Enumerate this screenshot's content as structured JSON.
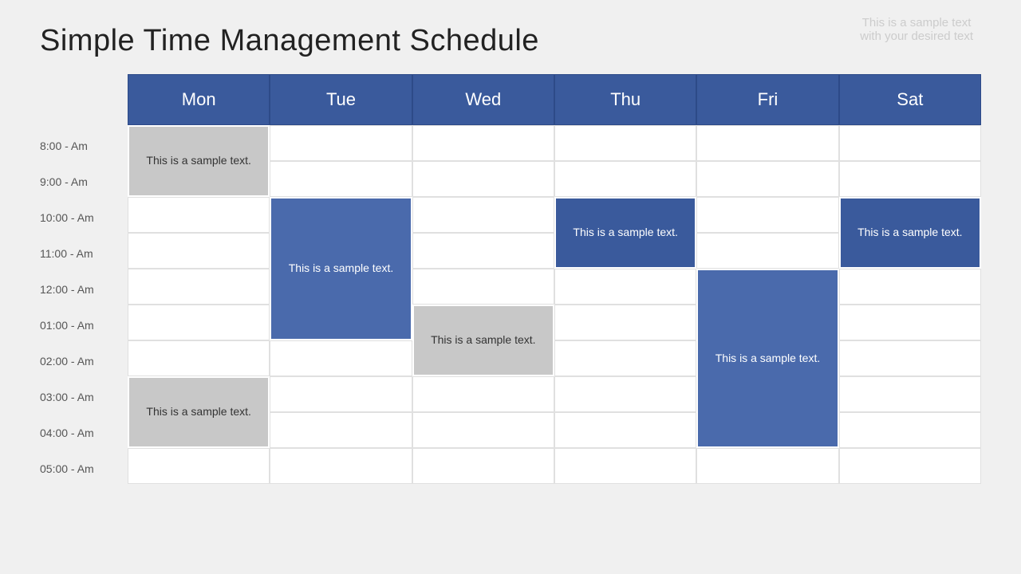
{
  "watermark": {
    "line1": "This is a sample text",
    "line2": "with your desired text"
  },
  "title": "Simple Time Management Schedule",
  "days": [
    "Mon",
    "Tue",
    "Wed",
    "Thu",
    "Fri",
    "Sat"
  ],
  "timeSlots": [
    "8:00 - Am",
    "9:00 - Am",
    "10:00 - Am",
    "11:00 - Am",
    "12:00 - Am",
    "01:00 - Am",
    "02:00 - Am",
    "03:00 - Am",
    "04:00 - Am",
    "05:00 - Am"
  ],
  "events": [
    {
      "id": "mon-1",
      "label": "This is a sample text.",
      "col": 1,
      "rowStart": 1,
      "rowEnd": 3,
      "color": "gray"
    },
    {
      "id": "tue-1",
      "label": "This is a sample text.",
      "col": 2,
      "rowStart": 3,
      "rowEnd": 7,
      "color": "blue-medium"
    },
    {
      "id": "thu-1",
      "label": "This is a sample text.",
      "col": 4,
      "rowStart": 3,
      "rowEnd": 5,
      "color": "blue-dark"
    },
    {
      "id": "wed-1",
      "label": "This is a sample text.",
      "col": 3,
      "rowStart": 6,
      "rowEnd": 8,
      "color": "gray"
    },
    {
      "id": "fri-1",
      "label": "This is a sample text.",
      "col": 5,
      "rowStart": 5,
      "rowEnd": 10,
      "color": "blue-medium"
    },
    {
      "id": "sat-1",
      "label": "This is a sample text.",
      "col": 6,
      "rowStart": 3,
      "rowEnd": 5,
      "color": "blue-dark"
    },
    {
      "id": "mon-2",
      "label": "This is a sample text.",
      "col": 1,
      "rowStart": 8,
      "rowEnd": 10,
      "color": "gray"
    }
  ],
  "colors": {
    "header-bg": "#3a5a9c",
    "blue-dark": "#3a5a9c",
    "blue-medium": "#4a6aac",
    "gray": "#c8c8c8",
    "gray-text": "#333333",
    "white-text": "#ffffff"
  }
}
